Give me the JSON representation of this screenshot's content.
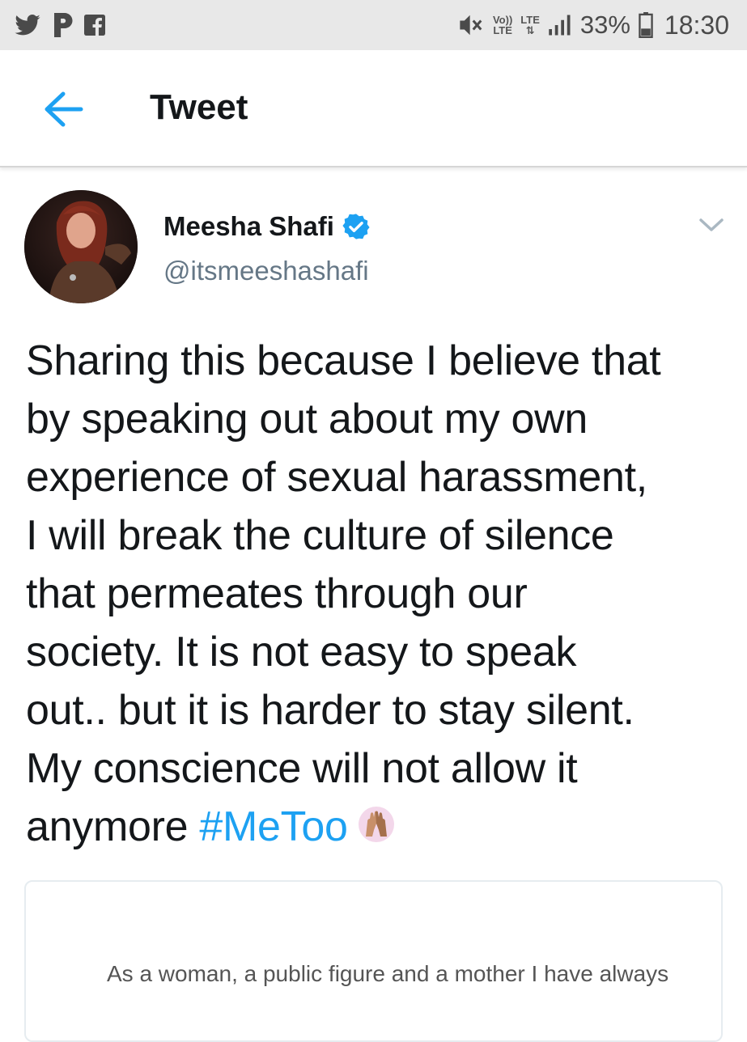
{
  "status_bar": {
    "icons_left": [
      "twitter-icon",
      "pinterest-icon",
      "facebook-icon"
    ],
    "network_volte": [
      "Vo))",
      "LTE"
    ],
    "network_lte": "LTE",
    "battery": "33%",
    "time": "18:30"
  },
  "header": {
    "title": "Tweet",
    "accent_color": "#1da1f2"
  },
  "tweet": {
    "author_name": "Meesha Shafi",
    "author_handle": "@itsmeeshashafi",
    "verified": true,
    "text_lines": [
      "Sharing this because I believe that",
      "by speaking out about my own",
      "experience of sexual harassment,",
      "I will break the culture of silence",
      "that permeates through our",
      "society. It is not easy to speak",
      "out.. but it is harder to stay silent.",
      "My conscience will not allow it",
      "anymore"
    ],
    "hashtag": "#MeToo",
    "hashtag_color": "#1da1f2",
    "emoji": "raised-hands-emoji"
  },
  "quote_card": {
    "snippet": "As a woman, a public figure and a mother I have always"
  }
}
